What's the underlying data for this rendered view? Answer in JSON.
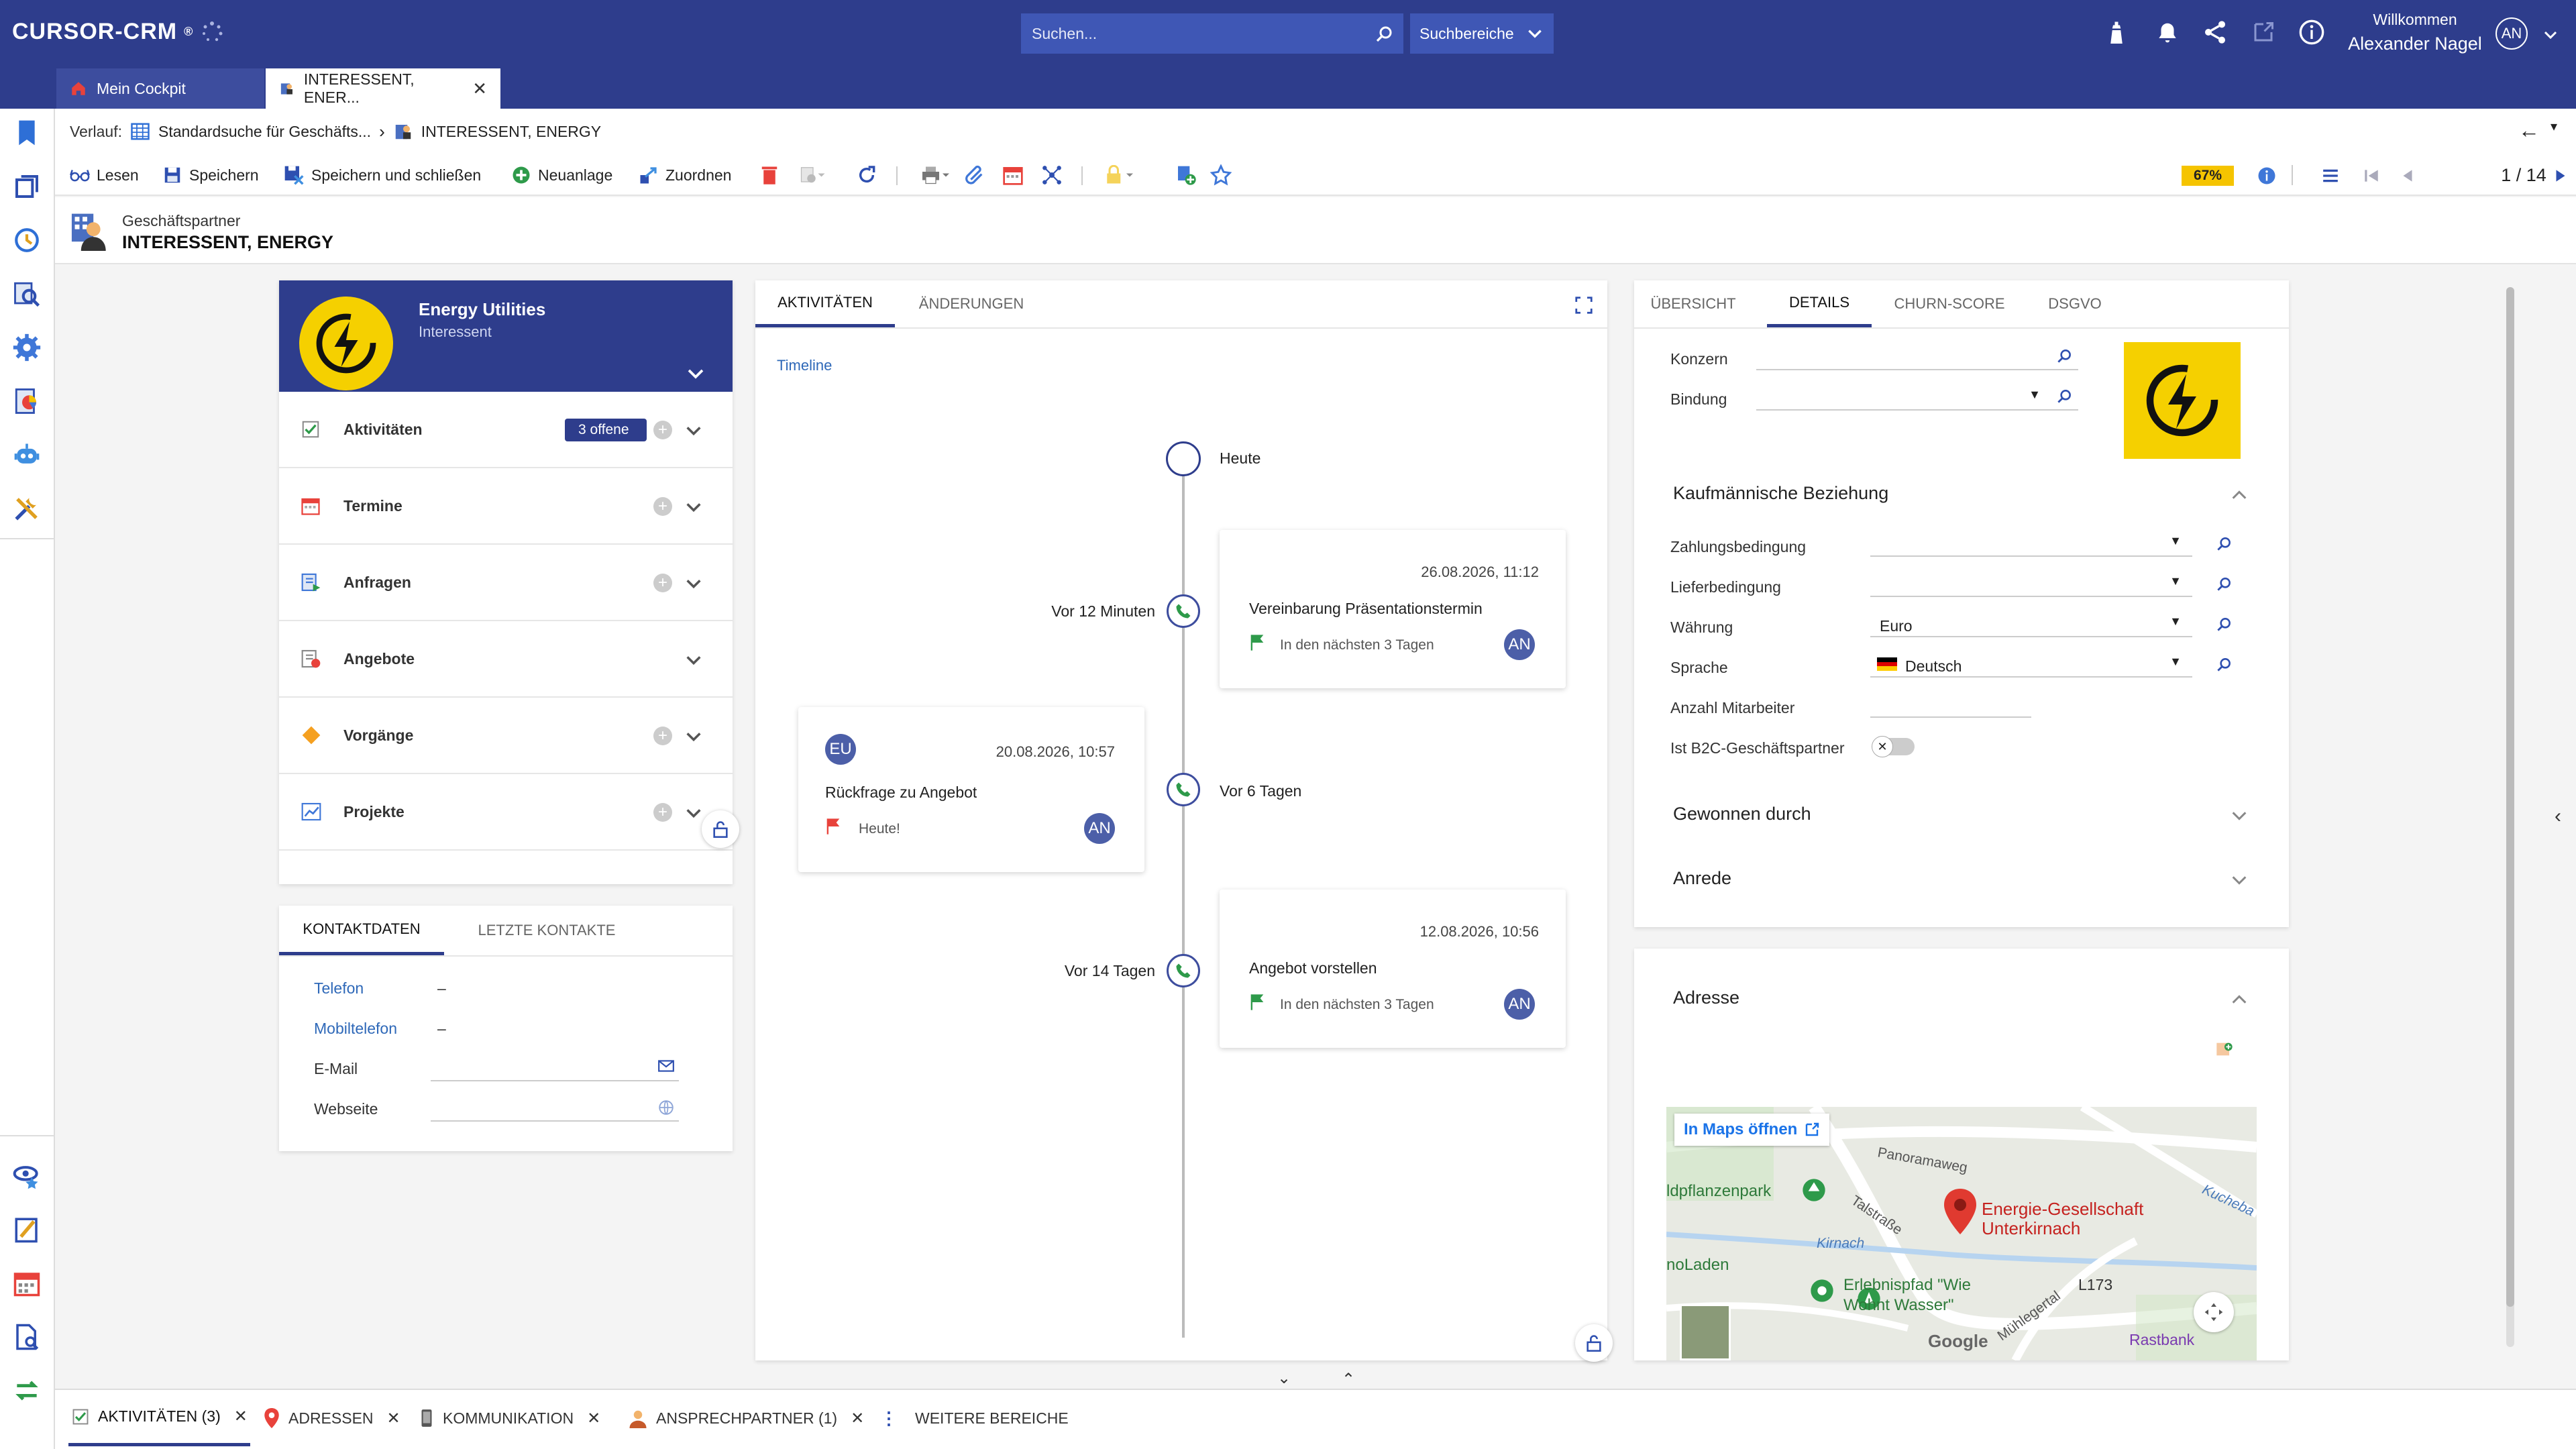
{
  "header": {
    "logo": "CURSOR-CRM",
    "search_placeholder": "Suchen...",
    "search_scope": "Suchbereiche",
    "welcome": "Willkommen",
    "user_name": "Alexander Nagel",
    "user_initials": "AN"
  },
  "tabs": [
    {
      "label": "Mein Cockpit"
    },
    {
      "label": "INTERESSENT, ENER..."
    }
  ],
  "breadcrumb": {
    "prefix": "Verlauf:",
    "item1": "Standardsuche für Geschäfts...",
    "item2": "INTERESSENT, ENERGY"
  },
  "toolbar": {
    "read": "Lesen",
    "save": "Speichern",
    "save_close": "Speichern und schließen",
    "new": "Neuanlage",
    "assign": "Zuordnen",
    "progress": "67%",
    "pager": "1 / 14"
  },
  "record": {
    "type": "Geschäftspartner",
    "name": "INTERESSENT, ENERGY"
  },
  "company_card": {
    "name": "Energy Utilities",
    "status": "Interessent"
  },
  "sections": [
    {
      "label": "Aktivitäten",
      "badge": "3 offene"
    },
    {
      "label": "Termine"
    },
    {
      "label": "Anfragen"
    },
    {
      "label": "Angebote"
    },
    {
      "label": "Vorgänge"
    },
    {
      "label": "Projekte"
    }
  ],
  "contact": {
    "tab_active": "KONTAKTDATEN",
    "tab_other": "LETZTE KONTAKTE",
    "phone_label": "Telefon",
    "phone_value": "–",
    "mobile_label": "Mobiltelefon",
    "mobile_value": "–",
    "email_label": "E-Mail",
    "web_label": "Webseite"
  },
  "timeline": {
    "tab_active": "AKTIVITÄTEN",
    "tab_other": "ÄNDERUNGEN",
    "title": "Timeline",
    "today": "Heute",
    "entries": [
      {
        "rel": "Vor 12 Minuten",
        "date": "26.08.2026, 11:12",
        "title": "Vereinbarung Präsentationstermin",
        "due": "In den nächsten 3 Tagen",
        "initials": "AN"
      },
      {
        "rel": "Vor 6 Tagen",
        "date": "20.08.2026, 10:57",
        "title": "Rückfrage zu Angebot",
        "due": "Heute!",
        "initials": "AN",
        "owner": "EU"
      },
      {
        "rel": "Vor 14 Tagen",
        "date": "12.08.2026, 10:56",
        "title": "Angebot vorstellen",
        "due": "In den nächsten 3 Tagen",
        "initials": "AN"
      }
    ]
  },
  "details": {
    "tabs": [
      "ÜBERSICHT",
      "DETAILS",
      "CHURN-SCORE",
      "DSGVO"
    ],
    "konzern_label": "Konzern",
    "bindung_label": "Bindung",
    "section_title": "Kaufmännische Beziehung",
    "zahlung_label": "Zahlungsbedingung",
    "liefer_label": "Lieferbedingung",
    "waehrung_label": "Währung",
    "waehrung_value": "Euro",
    "sprache_label": "Sprache",
    "sprache_value": "Deutsch",
    "mitarbeiter_label": "Anzahl Mitarbeiter",
    "b2c_label": "Ist B2C-Geschäftspartner",
    "gewonnen": "Gewonnen durch",
    "anrede": "Anrede"
  },
  "address": {
    "title": "Adresse",
    "maps_link": "In Maps öffnen",
    "place": "Energie-Gesellschaft Unterkirnach",
    "labels": {
      "panorama": "Panoramaweg",
      "tal": "Talstraße",
      "kirnach": "Kirnach",
      "kuche": "Kucheba",
      "park": "ldpflanzenpark",
      "laden": "noLaden",
      "pfad1": "Erlebnispfad \"Wie",
      "pfad2": "Wohnt Wasser\"",
      "road": "L173",
      "rast": "Rastbank",
      "google": "Google",
      "mhle": "Mühlegertal"
    }
  },
  "bottom": {
    "activities": "AKTIVITÄTEN (3)",
    "addresses": "ADRESSEN",
    "communication": "KOMMUNIKATION",
    "contacts": "ANSPRECHPARTNER (1)",
    "more": "WEITERE BEREICHE"
  },
  "colors": {
    "brand": "#2e3d8c",
    "progress": "#f5c400",
    "accent_yellow": "#f5d000",
    "link": "#2e68b8"
  }
}
